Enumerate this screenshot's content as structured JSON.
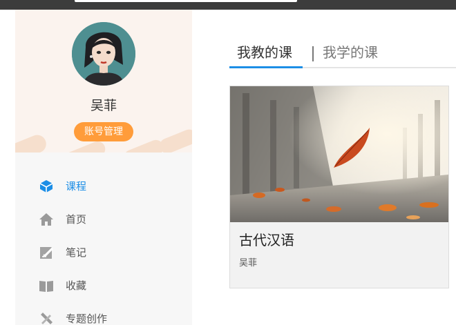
{
  "user": {
    "name": "吴菲",
    "account_button": "账号管理"
  },
  "nav": {
    "items": [
      {
        "label": "课程",
        "icon": "course-cube-icon",
        "active": true
      },
      {
        "label": "首页",
        "icon": "home-icon",
        "active": false
      },
      {
        "label": "笔记",
        "icon": "note-icon",
        "active": false
      },
      {
        "label": "收藏",
        "icon": "book-icon",
        "active": false
      },
      {
        "label": "专题创作",
        "icon": "create-tools-icon",
        "active": false
      }
    ]
  },
  "tabs": [
    {
      "label": "我教的课",
      "active": true
    },
    {
      "label": "我学的课",
      "active": false
    }
  ],
  "courses": [
    {
      "title": "古代汉语",
      "teacher": "吴菲"
    }
  ],
  "colors": {
    "accent": "#1c8ee6",
    "orange": "#ff9c3a",
    "sidebar_bg": "#f7f7f7",
    "profile_bg": "#fbf3ee"
  }
}
